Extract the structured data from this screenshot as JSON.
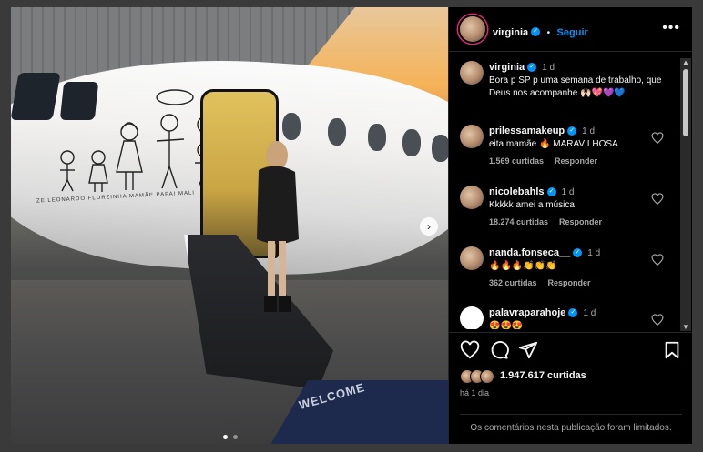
{
  "post": {
    "username": "virginia",
    "follow_label": "Seguir",
    "separator": "•",
    "more_label": "•••"
  },
  "media": {
    "drawing_caption": "ZE LEONARDO  FLORZINHA  MAMÃE        PAPAI        MALI",
    "mat_text": "WELCOME",
    "next_label": "›",
    "carousel_count": 2,
    "carousel_active": 1
  },
  "caption": {
    "username": "virginia",
    "time": "1 d",
    "text": "Bora p SP p uma semana de trabalho, que Deus nos acompanhe 🙌🏻💖💜💙"
  },
  "comments": [
    {
      "username": "prilessamakeup",
      "time": "1 d",
      "text": "eita mamãe 🔥 MARAVILHOSA",
      "likes": "1.569 curtidas",
      "reply": "Responder"
    },
    {
      "username": "nicolebahls",
      "time": "1 d",
      "text": "Kkkkk amei a música",
      "likes": "18.274 curtidas",
      "reply": "Responder"
    },
    {
      "username": "nanda.fonseca__",
      "time": "1 d",
      "text": "🔥🔥🔥👏👏👏",
      "likes": "362 curtidas",
      "reply": "Responder"
    },
    {
      "username": "palavraparahoje",
      "time": "1 d",
      "text": "😍😍😍",
      "likes": "",
      "reply": ""
    }
  ],
  "actions": {
    "likes_count": "1.947.617 curtidas",
    "time_ago": "há 1 dia",
    "comments_limited": "Os comentários nesta publicação foram limitados."
  },
  "colors": {
    "background": "#000000",
    "accent": "#0095f6",
    "muted": "#a8a8a8",
    "text": "#f5f5f5"
  },
  "icons": [
    "more-icon",
    "verified-icon",
    "heart-icon",
    "comment-icon",
    "share-icon",
    "bookmark-icon",
    "next-arrow-icon"
  ]
}
